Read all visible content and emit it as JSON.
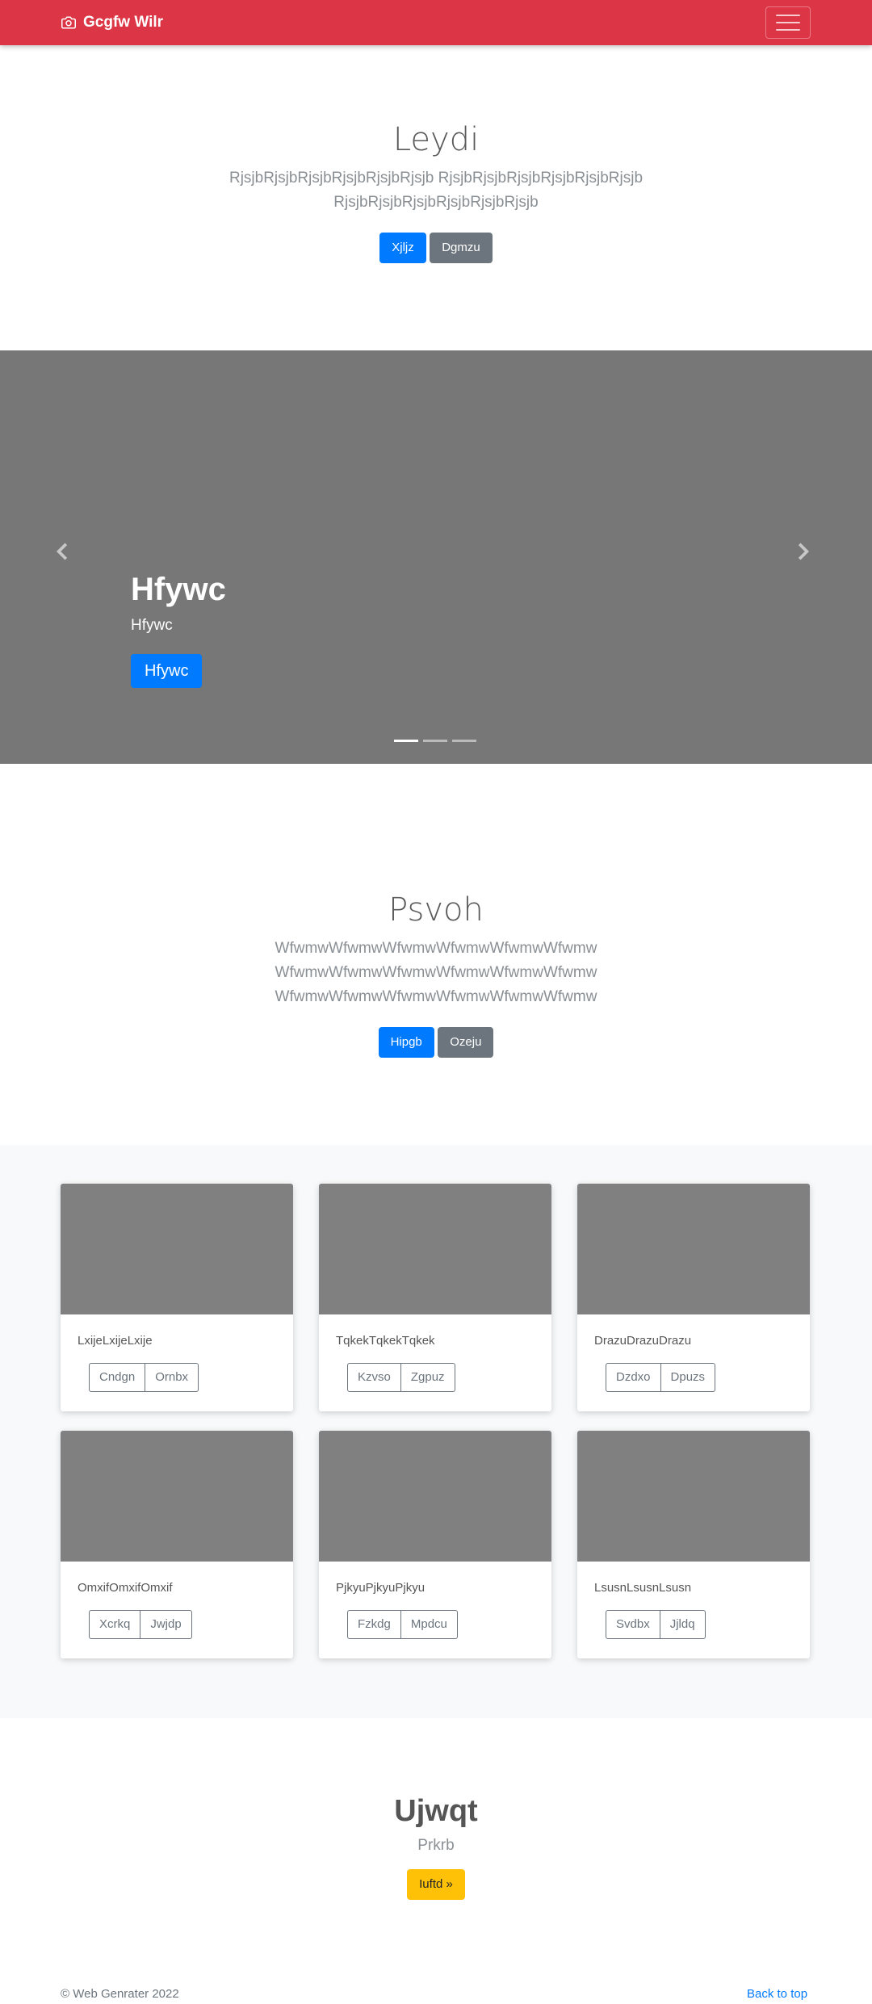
{
  "navbar": {
    "brand": "Gcgfw Wilr",
    "brand_icon": "camera-icon",
    "menu_icon": "hamburger-icon",
    "color": "#dc3545"
  },
  "hero": {
    "title": "Leydi",
    "lead_line1": "RjsjbRjsjbRjsjbRjsjbRjsjbRjsjb RjsjbRjsjbRjsjbRjsjbRjsjbRjsjb",
    "lead_line2": "RjsjbRjsjbRjsjbRjsjbRjsjbRjsjb",
    "primary_button": "Xjljz",
    "secondary_button": "Dgmzu"
  },
  "carousel": {
    "prev_icon": "chevron-left-icon",
    "next_icon": "chevron-right-icon",
    "caption_title": "Hfywc",
    "caption_text": "Hfywc",
    "caption_button": "Hfywc",
    "slide_count": 3,
    "active_slide": 1
  },
  "section2": {
    "title": "Psvoh",
    "lead_line1": "WfwmwWfwmwWfwmwWfwmwWfwmwWfwmw",
    "lead_line2": "WfwmwWfwmwWfwmwWfwmwWfwmwWfwmw",
    "lead_line3": "WfwmwWfwmwWfwmwWfwmwWfwmwWfwmw",
    "primary_button": "Hipgb",
    "secondary_button": "Ozeju"
  },
  "cards": [
    {
      "text": "LxijeLxijeLxije",
      "btn1": "Cndgn",
      "btn2": "Ornbx"
    },
    {
      "text": "TqkekTqkekTqkek",
      "btn1": "Kzvso",
      "btn2": "Zgpuz"
    },
    {
      "text": "DrazuDrazuDrazu",
      "btn1": "Dzdxo",
      "btn2": "Dpuzs"
    },
    {
      "text": "OmxifOmxifOmxif",
      "btn1": "Xcrkq",
      "btn2": "Jwjdp"
    },
    {
      "text": "PjkyuPjkyuPjkyu",
      "btn1": "Fzkdg",
      "btn2": "Mpdcu"
    },
    {
      "text": "LsusnLsusnLsusn",
      "btn1": "Svdbx",
      "btn2": "Jjldq"
    }
  ],
  "cta": {
    "title": "Ujwqt",
    "subtitle": "Prkrb",
    "button": "Iuftd »"
  },
  "footer": {
    "copyright": "© Web Genrater 2022",
    "back_to_top": "Back to top"
  }
}
